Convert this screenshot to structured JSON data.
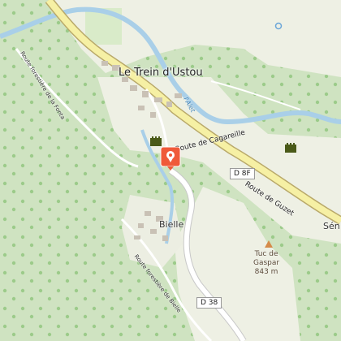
{
  "map": {
    "places": {
      "town": "Le Trein d'Ustou",
      "village": "Bielle",
      "edge_place": "Sén"
    },
    "roads": {
      "route_cagareille": "Route de Cagareille",
      "route_guzet": "Route de Guzet",
      "route_forestiere_fonta": "Route forestière de la Fonta",
      "route_forestiere_bielle": "Route forestière de Bielle"
    },
    "shields": {
      "d8f": "D 8F",
      "d38": "D 38"
    },
    "water": {
      "river_name": "l'Alet"
    },
    "peak": {
      "name_line1": "Tuc de",
      "name_line2": "Gaspar",
      "elevation": "843 m"
    },
    "icons": [
      "map-pin-icon",
      "castle-icon",
      "castle-icon",
      "peak-triangle-icon",
      "marker-circle-icon"
    ],
    "colors": {
      "forest": "#cfe3c1",
      "meadow": "#eef0e4",
      "water": "#a9cfe8",
      "primary_road": "#f6f0a4",
      "pin": "#ef5a3a",
      "castle": "#4a5a18"
    }
  }
}
